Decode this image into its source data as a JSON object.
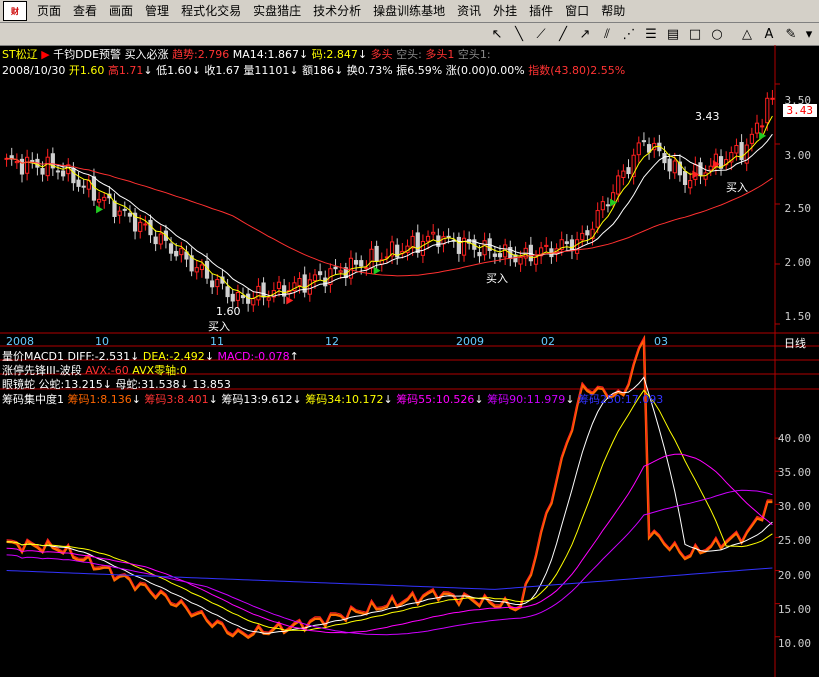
{
  "menu": [
    "页面",
    "查看",
    "画面",
    "管理",
    "程式化交易",
    "实盘猎庄",
    "技术分析",
    "操盘训练基地",
    "资讯",
    "外挂",
    "插件",
    "窗口",
    "帮助"
  ],
  "toolbar_icons": [
    "cursor-icon",
    "line-draw-icon",
    "ray-icon",
    "segment-icon",
    "arrow-icon",
    "parallel-icon",
    "fan-icon",
    "fibonacci-icon",
    "channel-icon",
    "text-icon",
    "rect-icon",
    "ellipse-icon",
    "triangle-icon",
    "paint-icon"
  ],
  "header": {
    "stock": "ST松辽",
    "indicator": "千钧DDE预警",
    "signal_name": "买入必涨",
    "trend_label": "趋势:2.796",
    "ma14": "MA14:1.867",
    "chips_label": "码:2.847",
    "bull": "多头",
    "empty1": "空头:",
    "bull2": "多头1",
    "empty2": "空头1:"
  },
  "quote": {
    "date": "2008/10/30",
    "open": "开1.60",
    "high": "高1.71",
    "low": "低1.60",
    "close": "收1.67",
    "volume": "量11101",
    "amount": "额186",
    "turnover": "换0.73%",
    "amplitude": "振6.59%",
    "change": "涨(0.00)0.00%",
    "index": "指数(43.80)2.55%"
  },
  "price_axis": [
    "3.50",
    "3.00",
    "2.50",
    "2.00",
    "1.50"
  ],
  "price_current": "3.43",
  "time_axis": [
    "2008",
    "10",
    "11",
    "12",
    "2009",
    "02",
    "03"
  ],
  "period": "日线",
  "annotations": {
    "buy": "买入",
    "low_price": "1.60",
    "high_price": "3.43"
  },
  "macd_line": {
    "name": "量价MACD1",
    "diff": "DIFF:-2.531",
    "dea": "DEA:-2.492",
    "macd": "MACD:-0.078"
  },
  "limit_line": {
    "name": "涨停先锋III-波段",
    "avx": "AVX:-60",
    "axis": "AVX零轴:0"
  },
  "glasses_line": {
    "name": "眼镜蛇",
    "male": "公蛇:13.215",
    "female": "母蛇:31.538",
    "third": "13.853"
  },
  "chips_line": {
    "name": "筹码集中度1",
    "c1": "筹码1:8.136",
    "c3": "筹码3:8.401",
    "c13": "筹码13:9.612",
    "c34": "筹码34:10.172",
    "c55": "筹码55:10.526",
    "c90": "筹码90:11.979",
    "c250": "筹码250:17.093"
  },
  "lower_axis": [
    "40.00",
    "35.00",
    "30.00",
    "25.00",
    "20.00",
    "15.00",
    "10.00"
  ],
  "colors": {
    "up": "#ff2020",
    "down": "#d0d0d0",
    "ma_white": "#ffffff",
    "ma_yellow": "#ffff00",
    "ma_red": "#ff3030",
    "bg": "#000000",
    "grid": "#8b0000"
  },
  "chart_data": {
    "type": "candlestick",
    "price_range": [
      1.45,
      3.55
    ],
    "lower_range": [
      8.0,
      45.0
    ],
    "segments": [
      {
        "from": 0,
        "to": 10,
        "start": 2.85,
        "end": 2.8
      },
      {
        "from": 10,
        "to": 30,
        "start": 2.8,
        "end": 2.2
      },
      {
        "from": 30,
        "to": 45,
        "start": 2.2,
        "end": 1.7
      },
      {
        "from": 45,
        "to": 55,
        "start": 1.7,
        "end": 1.8
      },
      {
        "from": 55,
        "to": 72,
        "start": 1.8,
        "end": 2.05
      },
      {
        "from": 72,
        "to": 85,
        "start": 2.05,
        "end": 2.25
      },
      {
        "from": 85,
        "to": 100,
        "start": 2.2,
        "end": 2.05
      },
      {
        "from": 100,
        "to": 112,
        "start": 2.05,
        "end": 2.2
      },
      {
        "from": 112,
        "to": 125,
        "start": 2.2,
        "end": 3.1
      },
      {
        "from": 125,
        "to": 132,
        "start": 3.0,
        "end": 2.7
      },
      {
        "from": 132,
        "to": 145,
        "start": 2.7,
        "end": 3.0
      },
      {
        "from": 145,
        "to": 149,
        "start": 3.05,
        "end": 3.43
      }
    ]
  }
}
